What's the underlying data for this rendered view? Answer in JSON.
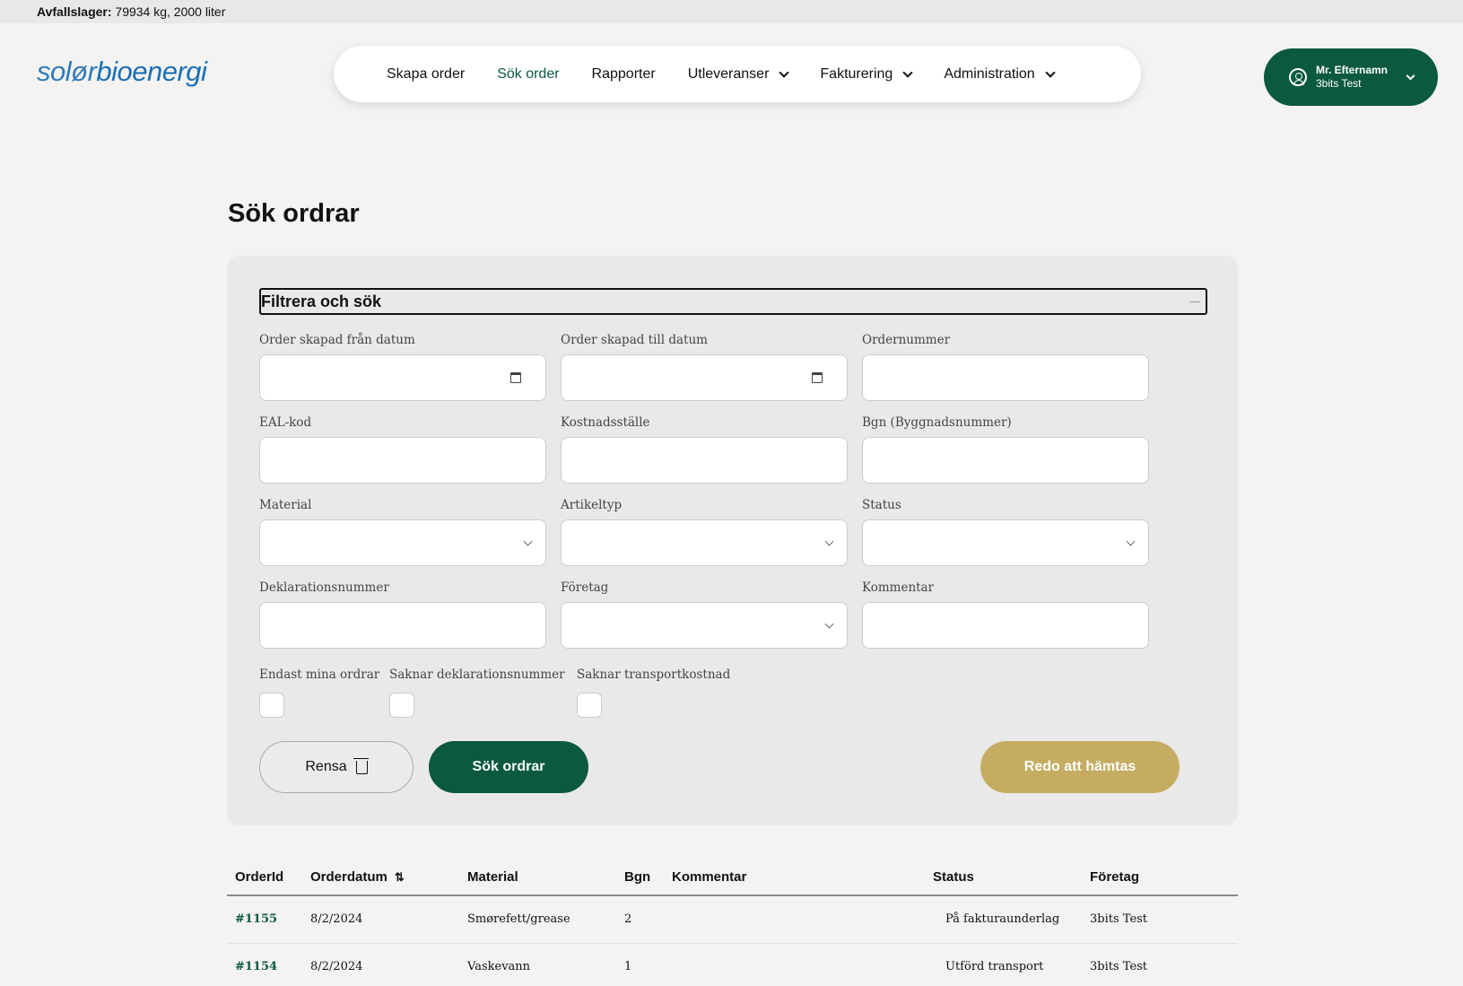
{
  "topbar": {
    "label": "Avfallslager:",
    "value": "79934 kg, 2000 liter"
  },
  "logo": {
    "part1": "solør",
    "part2": "bioenergi"
  },
  "nav": {
    "items": [
      {
        "label": "Skapa order"
      },
      {
        "label": "Sök order"
      },
      {
        "label": "Rapporter"
      },
      {
        "label": "Utleveranser"
      },
      {
        "label": "Fakturering"
      },
      {
        "label": "Administration"
      }
    ]
  },
  "user": {
    "name": "Mr. Efternamn",
    "company": "3bits Test"
  },
  "page": {
    "title": "Sök ordrar"
  },
  "filter": {
    "header": "Filtrera och sök",
    "fields": {
      "from_date": "Order skapad från datum",
      "to_date": "Order skapad till datum",
      "order_number": "Ordernummer",
      "eal": "EAL-kod",
      "cost_center": "Kostnadsställe",
      "bgn": "Bgn (Byggnadsnummer)",
      "material": "Material",
      "article_type": "Artikeltyp",
      "status": "Status",
      "declaration": "Deklarationsnummer",
      "company": "Företag",
      "comment": "Kommentar"
    },
    "checkboxes": {
      "mine": "Endast mina ordrar",
      "no_decl": "Saknar deklarationsnummer",
      "no_transport": "Saknar transportkostnad"
    },
    "buttons": {
      "clear": "Rensa",
      "search": "Sök ordrar",
      "ready": "Redo att hämtas"
    }
  },
  "table": {
    "headers": {
      "id": "OrderId",
      "date": "Orderdatum",
      "material": "Material",
      "bgn": "Bgn",
      "comment": "Kommentar",
      "status": "Status",
      "company": "Företag"
    },
    "rows": [
      {
        "id": "#1155",
        "date": "8/2/2024",
        "material": "Smørefett/grease",
        "bgn": "2",
        "comment": "",
        "status": "På fakturaunderlag",
        "company": "3bits Test"
      },
      {
        "id": "#1154",
        "date": "8/2/2024",
        "material": "Vaskevann",
        "bgn": "1",
        "comment": "",
        "status": "Utförd transport",
        "company": "3bits Test"
      }
    ]
  }
}
